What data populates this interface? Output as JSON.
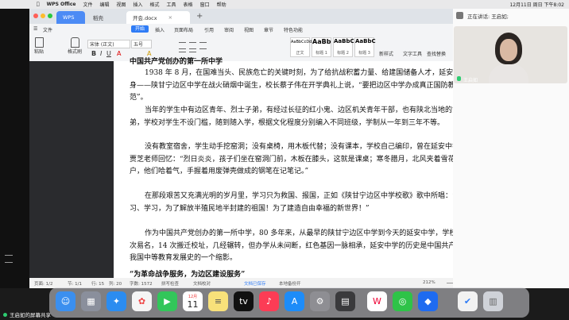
{
  "macos_menubar": {
    "app_name": "WPS Office",
    "menus": [
      "文件",
      "编辑",
      "视图",
      "插入",
      "格式",
      "工具",
      "表格",
      "窗口",
      "帮助"
    ],
    "clock": "12月11日 周日 下午8:02"
  },
  "tabs": [
    {
      "label": "WPS"
    },
    {
      "label": "稻壳"
    },
    {
      "label": "开会.docx"
    }
  ],
  "ribbon": {
    "menus": [
      "文件",
      "开始",
      "插入",
      "页面布局",
      "引用",
      "审阅",
      "视图",
      "章节",
      "特色功能"
    ],
    "active_menu": "开始",
    "font_name": "宋体 (正文)",
    "font_size": "五号",
    "styles": [
      {
        "preview": "AaBbCcDd",
        "name": "正文"
      },
      {
        "preview": "AaBb",
        "name": "标题 1"
      },
      {
        "preview": "AaBbC",
        "name": "标题 2"
      },
      {
        "preview": "AaBbC",
        "name": "标题 3"
      }
    ],
    "right_tools": [
      "新样式",
      "文字工具",
      "查找替换"
    ],
    "left_tools": [
      "粘贴",
      "格式刷"
    ]
  },
  "document": {
    "heading_partial": "中国共产党创办的第一所中学",
    "paragraphs": [
      "1938 年 8 月，在国难当头、民族危亡的关键时刻，为了给抗战积蓄力量、给建国储备人才，延安中学的前身——陕甘宁边区中学在战火硝烟中诞生，校长蔡子伟在开学典礼上说，“要把边区中学办成真正国防教育的模范”。",
      "当年的学生中有边区青年、烈士子弟，有经过长征的红小鬼、边区机关青年干部，也有陕北当地的贫困子弟，学校对学生不设门槛，随到随入学，根据文化程度分别编入不同班级，学制从一年到三年不等。",
      "没有教室宿舍，学生动手挖窑洞；没有桌椅，用木板代替；没有课本，学校自己编印，曾在延安中学任教的贾芝老师回忆：“烈日炎炎，孩子们坐在窑洞门前，木板在膝头，这就是课桌；寒冬腊月，北风夹着雪花吹打着窗户，他们哈着气，手握着用废弹壳做成的钢笔在记笔记。”",
      "在那段艰苦又充满光明的岁月里，学习只为救国、报国，正如《陕甘宁边区中学校歌》歌中所唱：“我们学习、学习，为了解放半殖民地半封建的祖国！为了建造自由幸福的新世界！”",
      "作为中国共产党创办的第一所中学，80 多年来，从最早的陕甘宁边区中学到今天的延安中学，学校先后 15 次易名，14 次搬迁校址，几经辗转，但办学从未间断，红色基因一脉相承，延安中学的历史是中国共产党领导下我国中等教育发展史的一个缩影。"
    ],
    "subheading": "“为革命战争服务，为边区建设服务”"
  },
  "statusbar": {
    "page": "页面: 1/2",
    "section": "节: 1/1",
    "row": "行: 15",
    "column": "列: 20",
    "words": "字数: 1572",
    "spellcheck": "拼写检查",
    "doc_check": "文档校对",
    "cloud": "文档已保存",
    "backup": "本地备份开",
    "zoom": "212%"
  },
  "meeting": {
    "speaking_label": "正在讲话: 王启如;",
    "participant_name": "王启如"
  },
  "dock": {
    "icons": [
      "finder-icon",
      "launchpad-icon",
      "safari-icon",
      "photos-icon",
      "facetime-icon",
      "calendar-icon",
      "notes-icon",
      "appletv-icon",
      "music-icon",
      "appstore-icon",
      "settings-icon",
      "calculator-icon",
      "wps-icon",
      "wechat-icon",
      "tencent-meeting-icon",
      "preview-icon",
      "trash-icon"
    ],
    "calendar_day": "11",
    "calendar_month": "12月"
  },
  "share_label": "王启如的屏幕共享"
}
